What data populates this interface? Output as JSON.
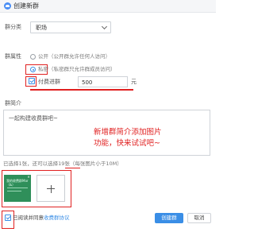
{
  "window": {
    "title": "创建新群"
  },
  "form": {
    "category_label": "群分类",
    "category_value": "职场",
    "attribute_label": "群属性",
    "public_option": "公开（公开群允许任何人访问）",
    "private_option": "私密（私密群只允许群成员访问）",
    "paid_checkbox_label": "付费进群",
    "paid_amount": "500",
    "currency_unit": "元",
    "intro_label": "群简介",
    "intro_placeholder": "一起构建收费群吧~",
    "image_hint": "已选择1张，还可以选择19张（每张图片小于10M）",
    "thumbnail_caption": "我的收费群Mar（&）"
  },
  "annotation": {
    "line1": "新增群简介添加图片",
    "line2": "功能，快来试试吧~"
  },
  "footer": {
    "agree_prefix": "已阅读并同意",
    "agree_link": "收费群协议",
    "create_button": "创建群",
    "cancel_button": "取消"
  },
  "colors": {
    "accent": "#3a8ee6",
    "highlight": "#e02020",
    "thumbnail": "#2f8f5a"
  },
  "icons": [
    "group-icon",
    "chevron-down-icon",
    "plus-icon",
    "close-icon",
    "checkbox-icon"
  ]
}
